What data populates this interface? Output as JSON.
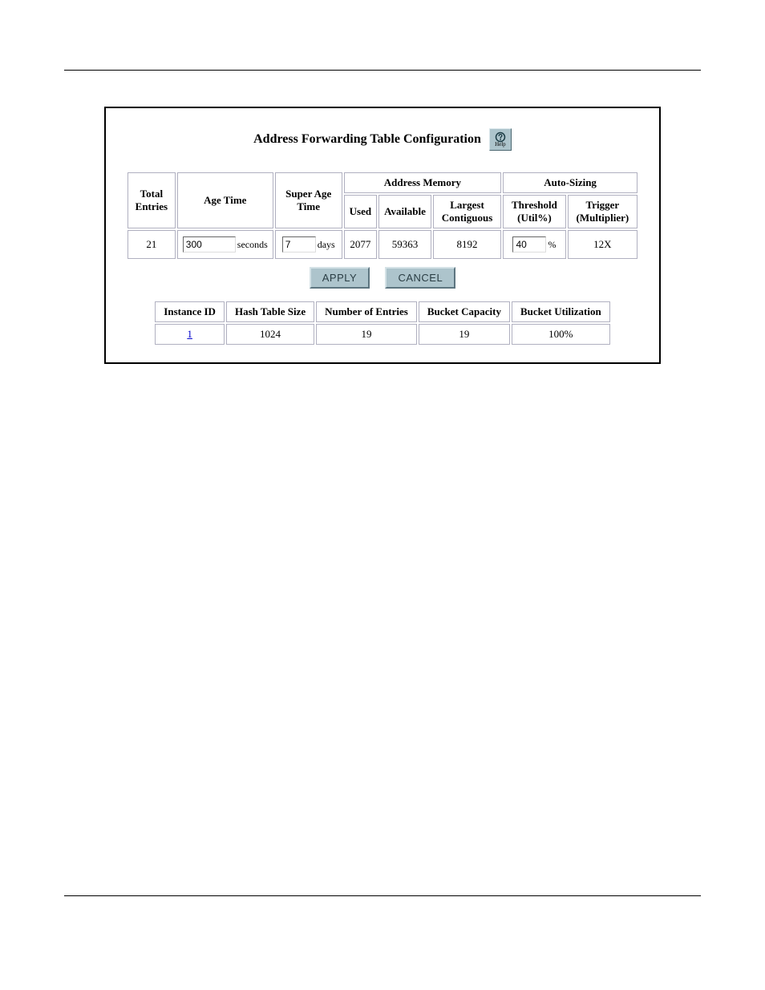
{
  "title": "Address Forwarding Table Configuration",
  "help_button": {
    "label": "Help"
  },
  "config_table": {
    "headers": {
      "total_entries": "Total Entries",
      "age_time": "Age Time",
      "super_age_time": "Super Age Time",
      "address_memory": "Address Memory",
      "used": "Used",
      "available": "Available",
      "largest_contiguous": "Largest Contiguous",
      "auto_sizing": "Auto-Sizing",
      "threshold": "Threshold (Util%)",
      "trigger": "Trigger (Multiplier)"
    },
    "units": {
      "age_time": "seconds",
      "super_age_time": "days",
      "threshold": "%"
    },
    "values": {
      "total_entries": "21",
      "age_time": "300",
      "super_age_time": "7",
      "used": "2077",
      "available": "59363",
      "largest_contiguous": "8192",
      "threshold": "40",
      "trigger": "12X"
    }
  },
  "actions": {
    "apply": "APPLY",
    "cancel": "CANCEL"
  },
  "instance_table": {
    "headers": {
      "instance_id": "Instance ID",
      "hash_table_size": "Hash Table Size",
      "number_of_entries": "Number of Entries",
      "bucket_capacity": "Bucket Capacity",
      "bucket_utilization": "Bucket Utilization"
    },
    "rows": [
      {
        "instance_id": "1",
        "hash_table_size": "1024",
        "number_of_entries": "19",
        "bucket_capacity": "19",
        "bucket_utilization": "100%"
      }
    ]
  }
}
